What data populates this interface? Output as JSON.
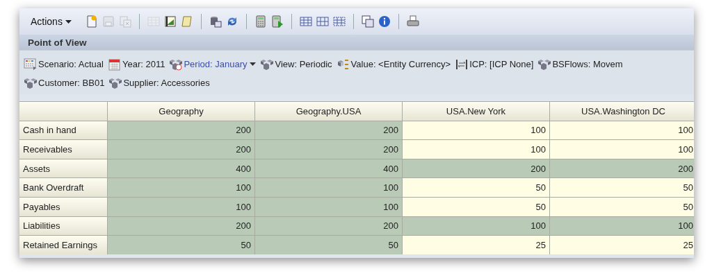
{
  "toolbar": {
    "actions_menu": "Actions",
    "groups": [
      [
        {
          "kind": "new",
          "disabled": false
        },
        {
          "kind": "save",
          "disabled": true
        },
        {
          "kind": "delete",
          "disabled": true
        }
      ],
      [
        {
          "kind": "grid",
          "disabled": true
        },
        {
          "kind": "chart",
          "disabled": false
        },
        {
          "kind": "scroll",
          "disabled": false
        }
      ],
      [
        {
          "kind": "database",
          "disabled": false
        },
        {
          "kind": "refresh",
          "disabled": false
        }
      ],
      [
        {
          "kind": "calculator",
          "disabled": false
        },
        {
          "kind": "calc-run",
          "disabled": false
        }
      ],
      [
        {
          "kind": "grid-rows",
          "disabled": false
        },
        {
          "kind": "grid-cols",
          "disabled": false
        },
        {
          "kind": "grid-dashed",
          "disabled": false
        }
      ],
      [
        {
          "kind": "copy",
          "disabled": false
        },
        {
          "kind": "info",
          "disabled": false
        }
      ],
      [
        {
          "kind": "print",
          "disabled": false
        }
      ]
    ]
  },
  "point_of_view": {
    "title": "Point of View",
    "rows": [
      [
        {
          "kind": "scenario",
          "label": "Scenario: Actual",
          "dropdown": false
        },
        {
          "kind": "calendar",
          "label": "Year: 2011",
          "dropdown": false
        },
        {
          "kind": "period",
          "label": "Period: January",
          "dropdown": true
        },
        {
          "kind": "dimension",
          "label": "View: Periodic",
          "dropdown": false
        },
        {
          "kind": "currency",
          "label": "Value: <Entity Currency>",
          "dropdown": false
        },
        {
          "kind": "icp",
          "label": "ICP: [ICP None]",
          "dropdown": false
        },
        {
          "kind": "dimension",
          "label": "BSFlows: Movem",
          "dropdown": false
        }
      ],
      [
        {
          "kind": "dimension",
          "label": "Customer: BB01",
          "dropdown": false
        },
        {
          "kind": "dimension",
          "label": "Supplier: Accessories",
          "dropdown": false
        }
      ]
    ]
  },
  "grid": {
    "columns": [
      "Geography",
      "Geography.USA",
      "USA.New York",
      "USA.Washington DC"
    ],
    "rows": [
      {
        "label": "Cash in hand",
        "cells": [
          {
            "value": "200",
            "kind": "calculated"
          },
          {
            "value": "200",
            "kind": "calculated"
          },
          {
            "value": "100",
            "kind": "input"
          },
          {
            "value": "100",
            "kind": "input"
          }
        ]
      },
      {
        "label": "Receivables",
        "cells": [
          {
            "value": "200",
            "kind": "calculated"
          },
          {
            "value": "200",
            "kind": "calculated"
          },
          {
            "value": "100",
            "kind": "input"
          },
          {
            "value": "100",
            "kind": "input"
          }
        ]
      },
      {
        "label": "Assets",
        "cells": [
          {
            "value": "400",
            "kind": "calculated"
          },
          {
            "value": "400",
            "kind": "calculated"
          },
          {
            "value": "200",
            "kind": "calculated"
          },
          {
            "value": "200",
            "kind": "calculated"
          }
        ]
      },
      {
        "label": "Bank Overdraft",
        "cells": [
          {
            "value": "100",
            "kind": "calculated"
          },
          {
            "value": "100",
            "kind": "calculated"
          },
          {
            "value": "50",
            "kind": "input"
          },
          {
            "value": "50",
            "kind": "input"
          }
        ]
      },
      {
        "label": "Payables",
        "cells": [
          {
            "value": "100",
            "kind": "calculated"
          },
          {
            "value": "100",
            "kind": "calculated"
          },
          {
            "value": "50",
            "kind": "input"
          },
          {
            "value": "50",
            "kind": "input"
          }
        ]
      },
      {
        "label": "Liabilities",
        "cells": [
          {
            "value": "200",
            "kind": "calculated"
          },
          {
            "value": "200",
            "kind": "calculated"
          },
          {
            "value": "100",
            "kind": "calculated"
          },
          {
            "value": "100",
            "kind": "calculated"
          }
        ]
      },
      {
        "label": "Retained Earnings",
        "cells": [
          {
            "value": "50",
            "kind": "calculated"
          },
          {
            "value": "50",
            "kind": "calculated"
          },
          {
            "value": "25",
            "kind": "input"
          },
          {
            "value": "25",
            "kind": "input"
          }
        ]
      }
    ]
  }
}
